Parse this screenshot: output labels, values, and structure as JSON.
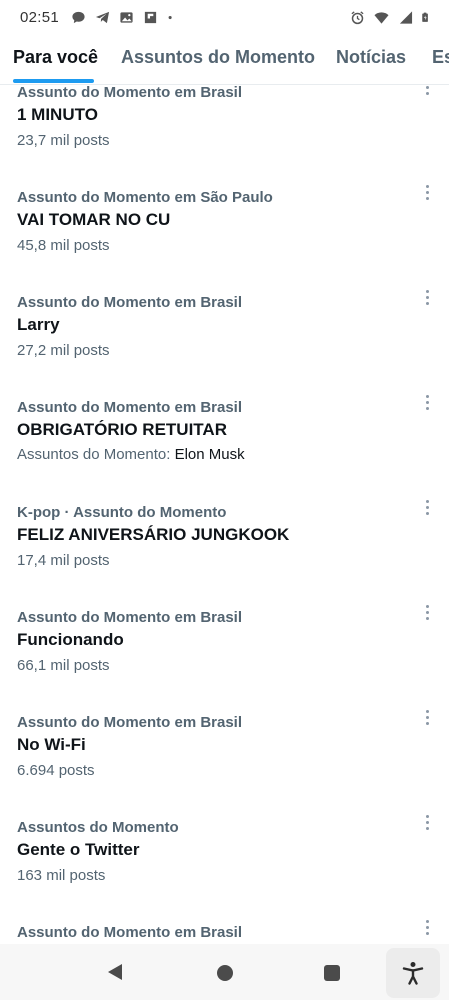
{
  "status_bar": {
    "time": "02:51",
    "left_icons": [
      "chat-bubble-icon",
      "telegram-icon",
      "gallery-icon",
      "flipboard-icon",
      "dot-icon"
    ],
    "right_icons": [
      "alarm-icon",
      "wifi-icon",
      "signal-icon",
      "battery-icon"
    ]
  },
  "tabs": [
    {
      "label": "Para você",
      "active": true
    },
    {
      "label": "Assuntos do Momento",
      "active": false
    },
    {
      "label": "Notícias",
      "active": false
    },
    {
      "label": "Es",
      "active": false
    }
  ],
  "trends": [
    {
      "context": "Assunto do Momento em Brasil",
      "title": "1 MINUTO",
      "count": "23,7 mil posts"
    },
    {
      "context": "Assunto do Momento em São Paulo",
      "title": "VAI TOMAR NO CU",
      "count": "45,8 mil posts"
    },
    {
      "context": "Assunto do Momento em Brasil",
      "title": "Larry",
      "count": "27,2 mil posts"
    },
    {
      "context": "Assunto do Momento em Brasil",
      "title": "OBRIGATÓRIO RETUITAR",
      "related_prefix": "Assuntos do Momento:",
      "related_name": "Elon Musk"
    },
    {
      "context": "K-pop · Assunto do Momento",
      "title": "FELIZ ANIVERSÁRIO JUNGKOOK",
      "count": "17,4 mil posts"
    },
    {
      "context": "Assunto do Momento em Brasil",
      "title": "Funcionando",
      "count": "66,1 mil posts"
    },
    {
      "context": "Assunto do Momento em Brasil",
      "title": "No Wi-Fi",
      "count": "6.694 posts"
    },
    {
      "context": "Assuntos do Momento",
      "title": "Gente o Twitter",
      "count": "163 mil posts"
    },
    {
      "context": "Assunto do Momento em Brasil"
    }
  ],
  "nav_bar": {
    "icons": [
      "back-icon",
      "home-icon",
      "recents-icon",
      "accessibility-icon"
    ]
  },
  "colors": {
    "accent": "#1d9bf0",
    "text_primary": "#0f1419",
    "text_secondary": "#536471"
  }
}
